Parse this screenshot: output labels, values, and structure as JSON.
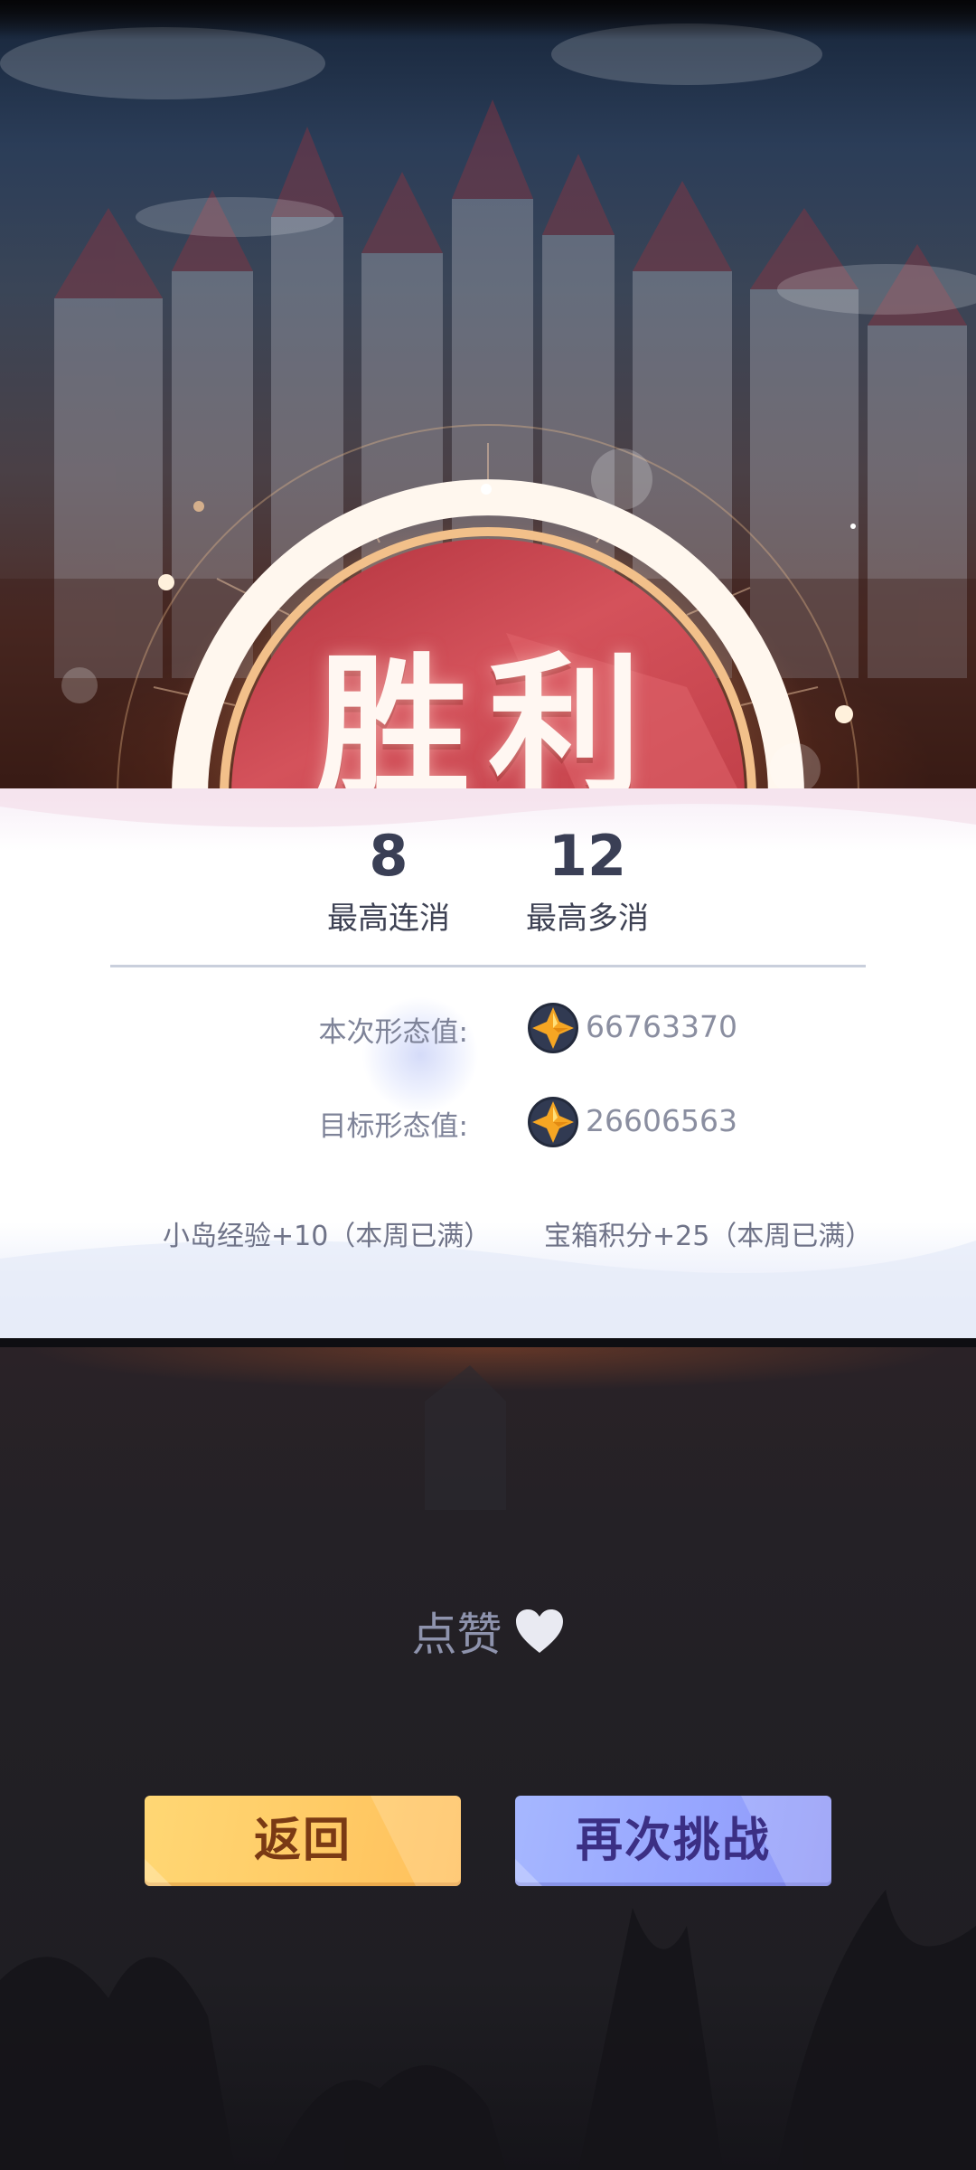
{
  "title": "胜利",
  "stats": [
    {
      "value": "8",
      "label": "最高连消"
    },
    {
      "value": "12",
      "label": "最高多消"
    }
  ],
  "form": {
    "current": {
      "label": "本次形态值:",
      "value": "66763370",
      "icon": "star-coin-icon"
    },
    "target": {
      "label": "目标形态值:",
      "value": "26606563",
      "icon": "star-coin-icon"
    }
  },
  "rewards": {
    "island_exp": "小岛经验+10（本周已满）",
    "chest_points": "宝箱积分+25（本周已满）"
  },
  "like": {
    "label": "点赞",
    "icon": "heart-icon"
  },
  "buttons": {
    "back": "返回",
    "retry": "再次挑战"
  },
  "colors": {
    "title_ribbon": "#c9464f",
    "back_button": "#ffcb66",
    "retry_button": "#97a6ff",
    "stat_text": "#3a3f55"
  }
}
